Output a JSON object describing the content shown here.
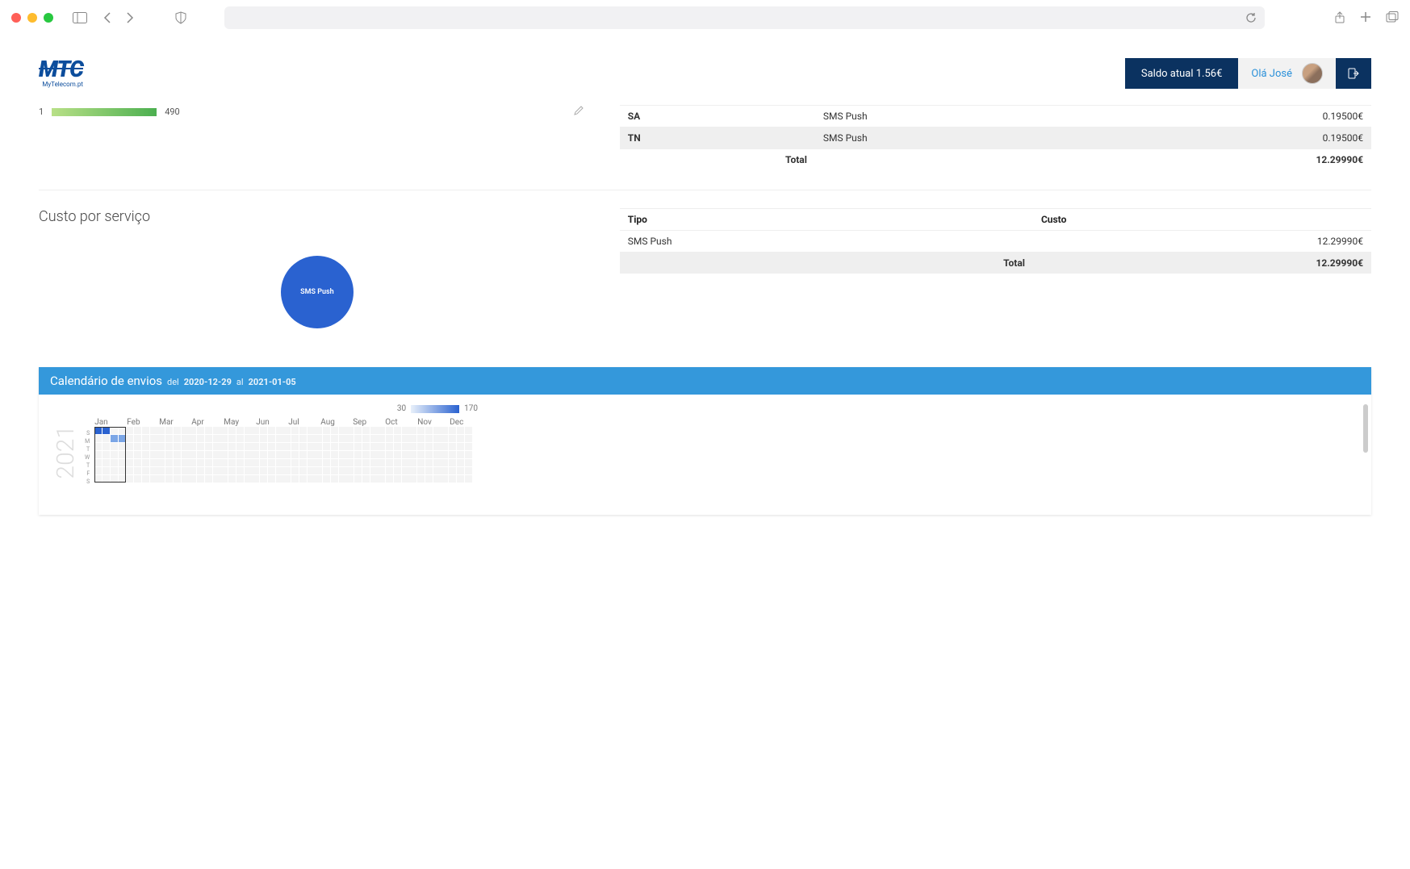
{
  "header": {
    "logo_main": "MTC",
    "logo_sub": "MyTelecom.pt",
    "saldo_label": "Saldo atual 1.56€",
    "user_greeting": "Olá José"
  },
  "top_bar": {
    "index_label": "1",
    "value_label": "490"
  },
  "country_table": {
    "rows": [
      {
        "code": "SA",
        "service": "SMS Push",
        "cost": "0.19500€"
      },
      {
        "code": "TN",
        "service": "SMS Push",
        "cost": "0.19500€"
      }
    ],
    "total_label": "Total",
    "total_value": "12.29990€"
  },
  "service_cost": {
    "title": "Custo por serviço",
    "pie_label": "SMS Push",
    "table": {
      "headers": {
        "tipo": "Tipo",
        "custo": "Custo"
      },
      "rows": [
        {
          "tipo": "SMS Push",
          "custo": "12.29990€"
        }
      ],
      "total_label": "Total",
      "total_value": "12.29990€"
    }
  },
  "calendar": {
    "title": "Calendário de envios",
    "sub_del": "del",
    "date_from": "2020-12-29",
    "sub_al": "al",
    "date_to": "2021-01-05",
    "legend_min": "30",
    "legend_max": "170",
    "year": "2021",
    "months": [
      "Jan",
      "Feb",
      "Mar",
      "Apr",
      "May",
      "Jun",
      "Jul",
      "Aug",
      "Sep",
      "Oct",
      "Nov",
      "Dec"
    ],
    "dow": [
      "S",
      "M",
      "T",
      "W",
      "T",
      "F",
      "S"
    ]
  },
  "chart_data": [
    {
      "type": "bar",
      "title": "",
      "categories": [
        "1"
      ],
      "values": [
        490
      ],
      "xlabel": "",
      "ylabel": "",
      "ylim": [
        0,
        500
      ]
    },
    {
      "type": "pie",
      "title": "Custo por serviço",
      "series": [
        {
          "name": "SMS Push",
          "values": [
            12.2999
          ]
        }
      ]
    },
    {
      "type": "heatmap",
      "title": "Calendário de envios",
      "xlabel": "month",
      "ylabel": "day-of-week",
      "legend_range": [
        30,
        170
      ],
      "year": 2021,
      "note": "Activity concentrated first week of Jan 2021; remaining year empty"
    }
  ]
}
